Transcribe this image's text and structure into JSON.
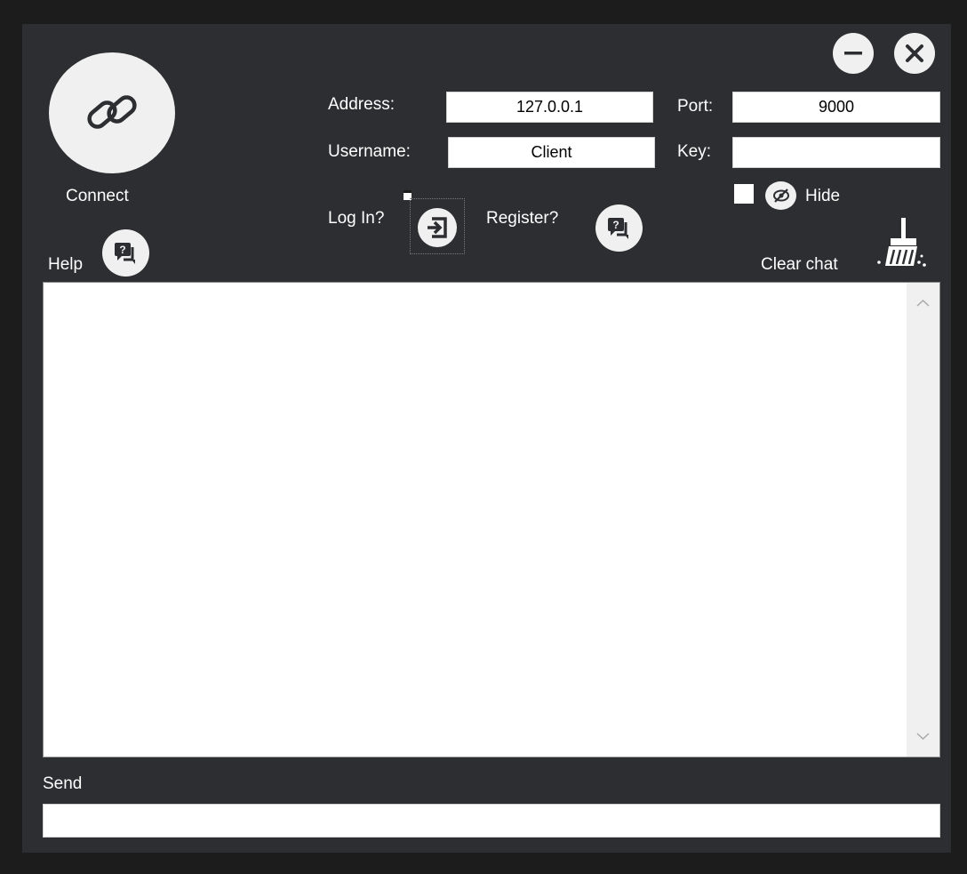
{
  "connect": {
    "label": "Connect",
    "icon": "link-icon"
  },
  "help": {
    "label": "Help",
    "icon": "help-chat-icon"
  },
  "window_controls": {
    "minimize_icon": "minimize-icon",
    "close_icon": "close-icon"
  },
  "form": {
    "address_label": "Address:",
    "address_value": "127.0.0.1",
    "port_label": "Port:",
    "port_value": "9000",
    "username_label": "Username:",
    "username_value": "Client",
    "key_label": "Key:",
    "key_value": "",
    "hide_label": "Hide",
    "hide_checked": false
  },
  "auth": {
    "login_label": "Log In?",
    "login_icon": "sign-in-icon",
    "register_label": "Register?",
    "register_icon": "help-chat-icon"
  },
  "chat": {
    "clear_label": "Clear chat",
    "clear_icon": "broom-icon",
    "messages": []
  },
  "send": {
    "label": "Send",
    "value": ""
  },
  "colors": {
    "background": "#2d2e31",
    "frame": "#1c1c1c",
    "button": "#f0f0f0",
    "text": "#ffffff"
  }
}
